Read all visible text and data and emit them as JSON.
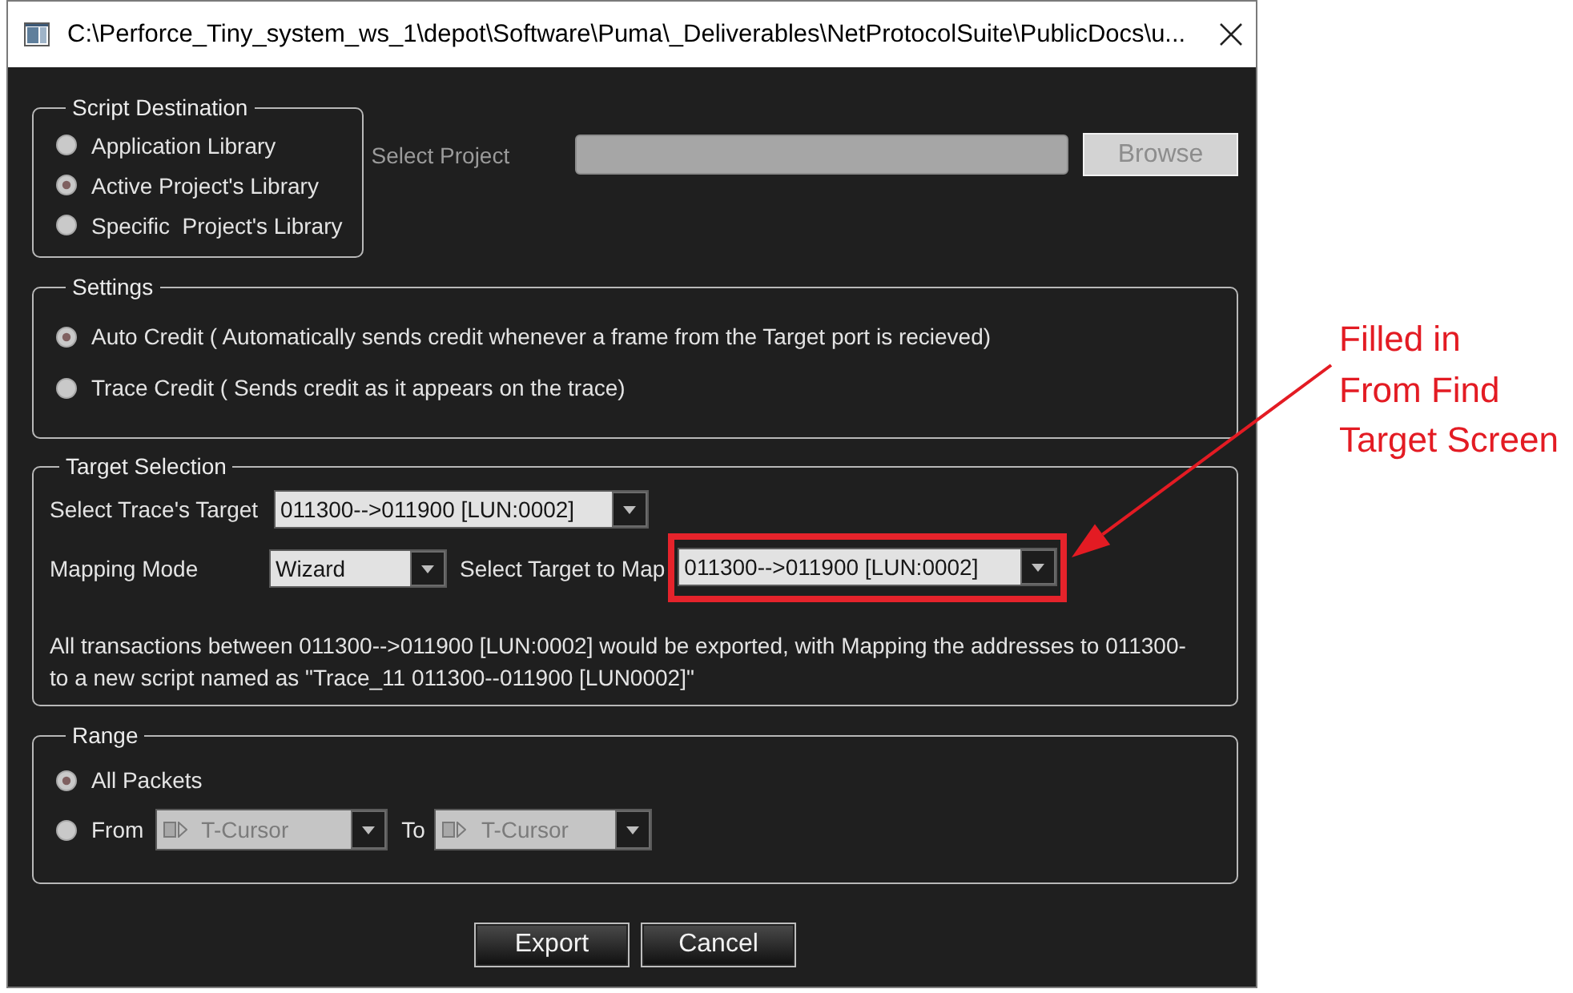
{
  "window": {
    "title": "C:\\Perforce_Tiny_system_ws_1\\depot\\Software\\Puma\\_Deliverables\\NetProtocolSuite\\PublicDocs\\u..."
  },
  "script_destination": {
    "title": "Script Destination",
    "options": [
      {
        "label": "Application Library",
        "selected": false
      },
      {
        "label": "Active Project's Library",
        "selected": true
      },
      {
        "label": "Specific  Project's Library",
        "selected": false
      }
    ],
    "select_project": {
      "label": "Select Project",
      "disabled": true
    },
    "browse_button": {
      "label": "Browse",
      "disabled": true
    }
  },
  "settings": {
    "title": "Settings",
    "options": [
      {
        "label": "Auto Credit ( Automatically sends credit whenever a frame from the Target port is recieved)",
        "selected": true
      },
      {
        "label": "Trace Credit ( Sends credit as it appears on the trace)",
        "selected": false
      }
    ]
  },
  "target_selection": {
    "title": "Target Selection",
    "trace_target": {
      "label": "Select Trace's Target",
      "value": "011300-->011900 [LUN:0002]"
    },
    "mapping_mode": {
      "label": "Mapping Mode",
      "value": "Wizard"
    },
    "target_to_map": {
      "label": "Select Target to Map",
      "value": "011300-->011900 [LUN:0002]",
      "highlighted": true
    },
    "description": [
      "All transactions between 011300-->011900 [LUN:0002] would be exported, with Mapping the addresses to 011300-",
      "to a new script named as \"Trace_11 011300--011900 [LUN0002]\""
    ]
  },
  "range": {
    "title": "Range",
    "options": [
      {
        "kind": "all",
        "label": "All Packets",
        "selected": true
      },
      {
        "kind": "span",
        "label": "From",
        "selected": false,
        "start": {
          "value": "T-Cursor",
          "disabled": true
        },
        "to_label": "To",
        "end": {
          "value": "T-Cursor",
          "disabled": true
        }
      }
    ]
  },
  "buttons": [
    {
      "label": "Export"
    },
    {
      "label": "Cancel"
    }
  ],
  "annotation": {
    "lines": [
      "Filled in",
      "From Find",
      "Target Screen"
    ]
  }
}
